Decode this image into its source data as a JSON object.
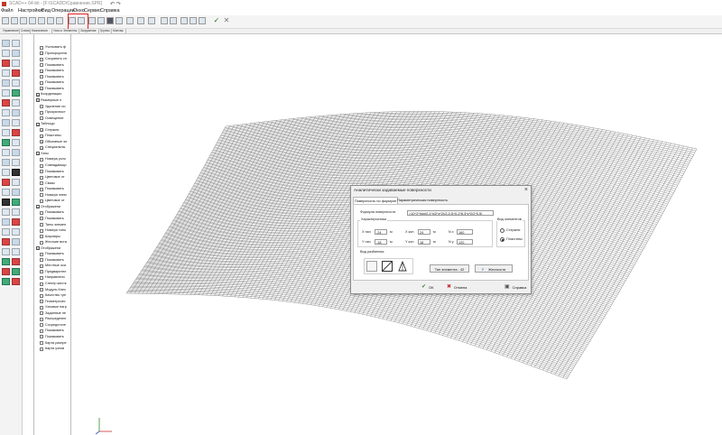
{
  "app": {
    "title": "SCAD++ 64-bit - [F:\\SCADD\\Сравнение.SPR]",
    "quick_access": "↶ ↷"
  },
  "menu": [
    "Файл",
    "Настройки",
    "Вид",
    "Операции",
    "Окно",
    "Сервис",
    "Справка"
  ],
  "tabs": [
    "Управление",
    "Схема",
    "Назначения",
    "Узлы и Элементы",
    "Загружения",
    "Группы",
    "Монтаж"
  ],
  "flags_panel": {
    "rows": [
      {
        "label": "Учитывать ф",
        "checked": false,
        "group": false
      },
      {
        "label": "Пропорциона",
        "checked": true,
        "group": false
      },
      {
        "label": "Сохранять сп",
        "checked": false,
        "group": false
      },
      {
        "label": "Показывать",
        "checked": false,
        "group": false
      },
      {
        "label": "Показывать",
        "checked": true,
        "group": false
      },
      {
        "label": "Показывать",
        "checked": false,
        "group": false
      },
      {
        "label": "Показывать",
        "checked": false,
        "group": false
      },
      {
        "label": "Показывать",
        "checked": true,
        "group": false
      },
      {
        "label": "Координацио",
        "checked": false,
        "group": true
      },
      {
        "label": "Размерные л",
        "checked": false,
        "group": true
      },
      {
        "label": "Удаление ли",
        "checked": false,
        "group": false
      },
      {
        "label": "Прозрачност",
        "checked": false,
        "group": false
      },
      {
        "label": "Освещение",
        "checked": false,
        "group": false
      },
      {
        "label": "Таблицы",
        "checked": false,
        "group": true
      },
      {
        "label": "Стержни",
        "checked": true,
        "group": false
      },
      {
        "label": "Пластины",
        "checked": true,
        "group": false
      },
      {
        "label": "Объемные эл",
        "checked": true,
        "group": false
      },
      {
        "label": "Специальны",
        "checked": true,
        "group": false
      },
      {
        "label": "Узлы",
        "checked": false,
        "group": true
      },
      {
        "label": "Номера узло",
        "checked": false,
        "group": false
      },
      {
        "label": "Совпадающи",
        "checked": false,
        "group": false
      },
      {
        "label": "Показывать",
        "checked": false,
        "group": false
      },
      {
        "label": "Цветовое от",
        "checked": false,
        "group": false
      },
      {
        "label": "Связи",
        "checked": false,
        "group": false
      },
      {
        "label": "Показывать",
        "checked": false,
        "group": false
      },
      {
        "label": "Номера элем",
        "checked": false,
        "group": false
      },
      {
        "label": "Цветовое от",
        "checked": false,
        "group": false
      },
      {
        "label": "Отображени",
        "checked": false,
        "group": true
      },
      {
        "label": "Показывать",
        "checked": false,
        "group": false
      },
      {
        "label": "Показывать",
        "checked": false,
        "group": false
      },
      {
        "label": "Типы элемен",
        "checked": false,
        "group": false
      },
      {
        "label": "Номера типо",
        "checked": false,
        "group": false
      },
      {
        "label": "Шарниры",
        "checked": false,
        "group": false
      },
      {
        "label": "Жесткие вста",
        "checked": false,
        "group": false
      },
      {
        "label": "Отображени",
        "checked": false,
        "group": true
      },
      {
        "label": "Показывать",
        "checked": false,
        "group": false
      },
      {
        "label": "Показывать",
        "checked": false,
        "group": false
      },
      {
        "label": "Местные оси",
        "checked": false,
        "group": false
      },
      {
        "label": "Предварител",
        "checked": false,
        "group": false
      },
      {
        "label": "Направлени",
        "checked": false,
        "group": false
      },
      {
        "label": "Спектр жестк",
        "checked": false,
        "group": false
      },
      {
        "label": "Модуль Кнез",
        "checked": false,
        "group": false
      },
      {
        "label": "Качество тре",
        "checked": false,
        "group": false
      },
      {
        "label": "Геометричес",
        "checked": false,
        "group": false
      },
      {
        "label": "Узловые нагр",
        "checked": false,
        "group": false
      },
      {
        "label": "Заданные пе",
        "checked": false,
        "group": false
      },
      {
        "label": "Распределен",
        "checked": false,
        "group": false
      },
      {
        "label": "Сосредоточе",
        "checked": false,
        "group": false
      },
      {
        "label": "Показывать",
        "checked": false,
        "group": false
      },
      {
        "label": "Показывать",
        "checked": false,
        "group": false
      },
      {
        "label": "Карта распре",
        "checked": false,
        "group": false
      },
      {
        "label": "Карта узлов",
        "checked": false,
        "group": false
      }
    ]
  },
  "dialog": {
    "title": "Аналитически задаваемые поверхности",
    "close": "×",
    "tabs": [
      "Поверхность по формуле",
      "Параметрическая поверхность"
    ],
    "formula_label": "Формула поверхности",
    "formula_value": "=10^2*(sin(0.1*x/2*z*2)/2-0.5+0.2*8.3*y*2/2*0.5)",
    "characteristics_label": "Характеристики",
    "x_start_label": "X нач",
    "x_start": "-24",
    "x_end_label": "X кон",
    "x_end": "24",
    "nx_label": "N x",
    "nx": "160",
    "y_start_label": "Y нач",
    "y_start": "-18",
    "y_end_label": "Y кон",
    "y_end": "18",
    "ny_label": "N y",
    "ny": "120",
    "unit": "м",
    "element_type_label": "Вид элементов",
    "element_types": [
      "Стержни",
      "Пластины"
    ],
    "partition_label": "Вид разбиения",
    "element_type_button": "Тип элемента - 42",
    "stiffness_button": "Жесткости",
    "ok": "ОК",
    "cancel": "Отмена",
    "help": "Справка"
  },
  "colors": {
    "mesh": "#5c5c5c",
    "highlight": "#e02020",
    "ok_icon": "#2e8b2e",
    "cancel_icon": "#c62828",
    "help_icon": "#1e4fb0"
  }
}
